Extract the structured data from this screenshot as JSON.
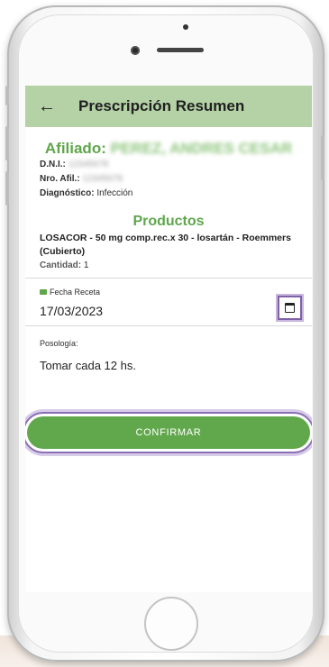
{
  "appbar": {
    "back_icon": "arrow-left-icon",
    "title": "Prescripción Resumen"
  },
  "afiliado": {
    "label": "Afiliado:",
    "name": "PEREZ, ANDRES CESAR",
    "dni_label": "D.N.I.:",
    "dni_value": "12345678",
    "nro_label": "Nro. Afil.:",
    "nro_value": "12345678",
    "diag_label": "Diagnóstico:",
    "diag_value": "Infección"
  },
  "productos": {
    "title": "Productos",
    "item": "LOSACOR - 50 mg comp.rec.x 30 - losartán - Roemmers (Cubierto)",
    "cantidad_label": "Cantidad:",
    "cantidad_value": "1"
  },
  "fecha": {
    "label": "Fecha Receta",
    "value": "17/03/2023",
    "label_icon": "calendar-icon",
    "picker_icon": "calendar-icon"
  },
  "posologia": {
    "label": "Posología:",
    "value": "Tomar cada 12 hs."
  },
  "confirm": {
    "label": "CONFIRMAR"
  },
  "colors": {
    "appbar": "#b4d2a6",
    "accent": "#61a84d",
    "focus": "#7f61a5"
  }
}
